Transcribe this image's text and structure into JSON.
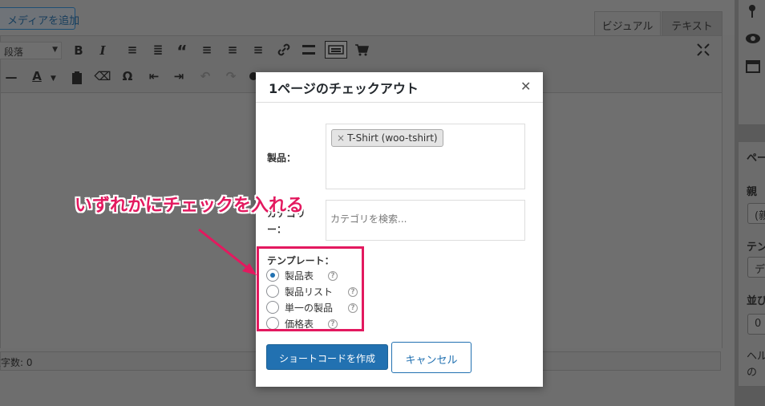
{
  "editor": {
    "add_media_label": "メディアを追加",
    "tabs": [
      {
        "label": "ビジュアル"
      },
      {
        "label": "テキスト"
      }
    ],
    "format_select_value": "段落",
    "word_count": "文字数: 0"
  },
  "sidebar": {
    "box2_heading": "ペー",
    "parent_label": "親",
    "parent_value": "(親",
    "template_label": "テン",
    "template_value": "デ",
    "order_label": "並び",
    "order_value": "0",
    "help_line1": "ヘル",
    "help_line2": "の"
  },
  "modal": {
    "title": "1ページのチェックアウト",
    "close_icon": "close-icon",
    "products_label": "製品：",
    "product_tag": "T-Shirt (woo-tshirt)",
    "tag_remove": "×",
    "category_label": "カテゴリー：",
    "category_placeholder": "カテゴリを検索...",
    "template_label": "テンプレート：",
    "template_options": [
      {
        "label": "製品表",
        "checked": true
      },
      {
        "label": "製品リスト",
        "checked": false
      },
      {
        "label": "単一の製品",
        "checked": false
      },
      {
        "label": "価格表",
        "checked": false
      }
    ],
    "help_glyph": "?",
    "create_button": "ショートコードを作成",
    "cancel_button": "キャンセル"
  },
  "annotation": {
    "text": "いずれかにチェックを入れる",
    "color": "#e3195f"
  },
  "colors": {
    "primary": "#2271b1",
    "annotation": "#e3195f"
  }
}
